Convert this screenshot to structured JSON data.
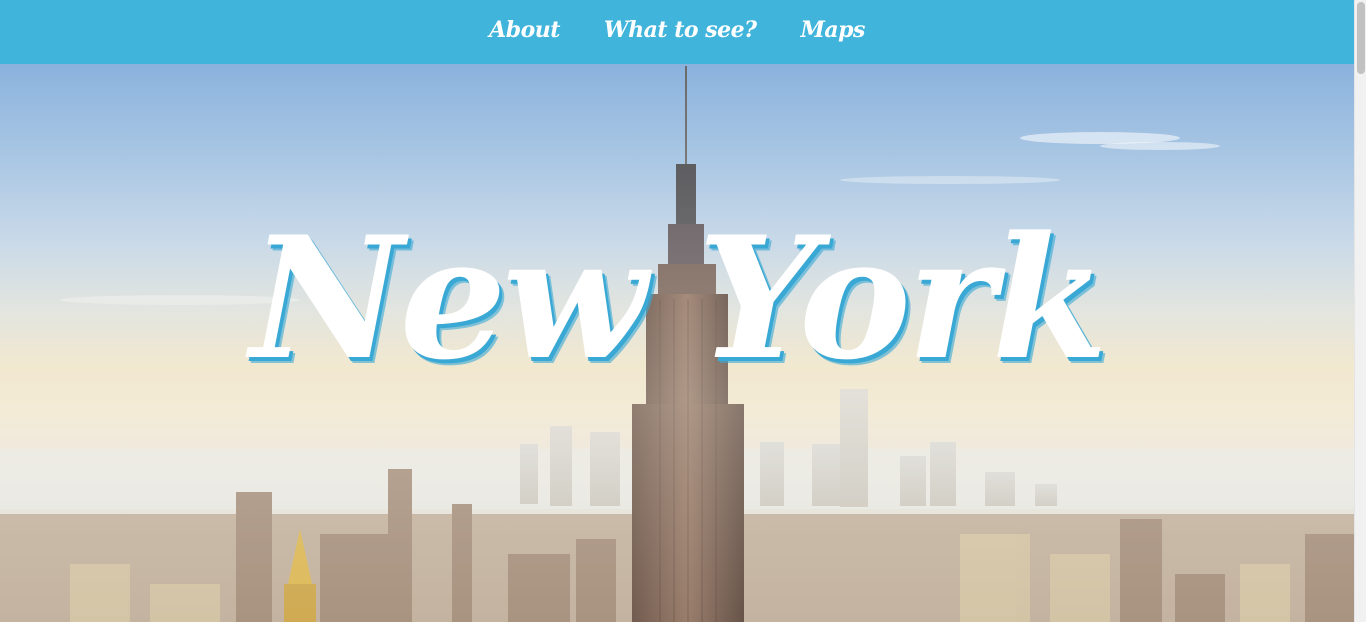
{
  "nav": {
    "items": [
      {
        "label": "About"
      },
      {
        "label": "What to see?"
      },
      {
        "label": "Maps"
      }
    ],
    "background_color": "#41b4dc"
  },
  "hero": {
    "title": "New York",
    "title_shadow_color": "#3aa8d4",
    "image": "city-skyline-photo"
  }
}
